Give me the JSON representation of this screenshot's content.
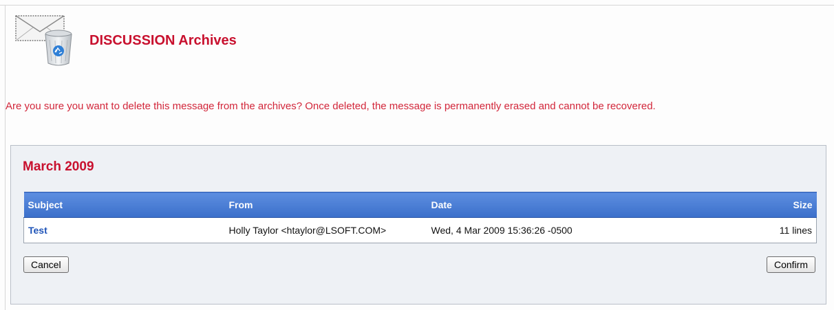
{
  "header": {
    "title": "DISCUSSION Archives",
    "logo_icon": "archive-trash-icon"
  },
  "warning": {
    "text": "Are you sure you want to delete this message from the archives? Once deleted, the message is permanently erased and cannot be recovered."
  },
  "archive": {
    "month": "March 2009",
    "columns": {
      "subject": "Subject",
      "from": "From",
      "date": "Date",
      "size": "Size"
    },
    "rows": [
      {
        "subject": "Test",
        "from": "Holly Taylor <htaylor@LSOFT.COM>",
        "date": "Wed, 4 Mar 2009 15:36:26 -0500",
        "size": "11 lines"
      }
    ]
  },
  "actions": {
    "cancel_label": "Cancel",
    "confirm_label": "Confirm"
  },
  "colors": {
    "title_red": "#c8102e",
    "warning_red": "#d2263a",
    "header_blue": "#3b6fca",
    "link_blue": "#1f54b8",
    "panel_bg": "#eef1f5"
  }
}
